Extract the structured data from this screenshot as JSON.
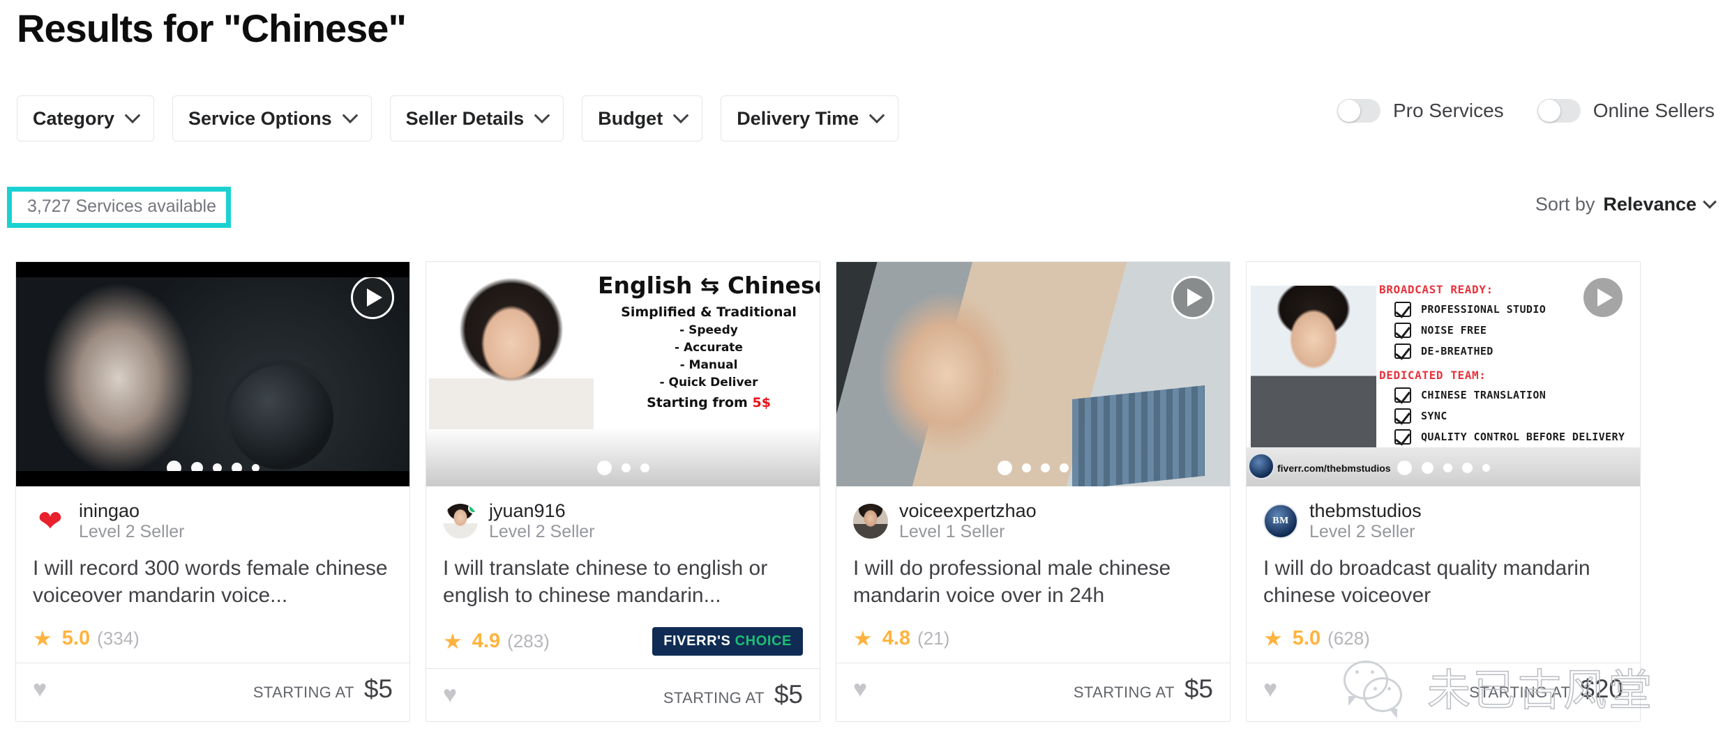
{
  "header": {
    "title": "Results for \"Chinese\""
  },
  "filters": {
    "buttons": [
      {
        "label": "Category",
        "icon": "chevron-down-icon"
      },
      {
        "label": "Service Options",
        "icon": "chevron-down-icon"
      },
      {
        "label": "Seller Details",
        "icon": "chevron-down-icon"
      },
      {
        "label": "Budget",
        "icon": "chevron-down-icon"
      },
      {
        "label": "Delivery Time",
        "icon": "chevron-down-icon"
      }
    ],
    "toggles": [
      {
        "label": "Pro Services",
        "on": false
      },
      {
        "label": "Online Sellers",
        "on": false
      }
    ]
  },
  "results": {
    "count_text": "3,727 Services available",
    "highlight_color": "#1ad1d1",
    "sort_prefix": "Sort by",
    "sort_value": "Relevance",
    "sort_icon": "chevron-down-icon"
  },
  "cards": [
    {
      "media_kind": "studio",
      "has_play": true,
      "play_icon": "play-button-icon",
      "dots": 5,
      "avatar_kind": "heart",
      "avatar_glyph": "❤",
      "avatar_icon": "heart-avatar-icon",
      "online": false,
      "seller": "iningao",
      "level": "Level 2 Seller",
      "title": "I will record 300 words female chinese voiceover mandarin voice...",
      "star_icon": "star-icon",
      "score": "5.0",
      "reviews": "(334)",
      "badge": null,
      "fav_icon": "heart-outline-icon",
      "fav_glyph": "♥",
      "price_label": "STARTING AT",
      "price": "$5"
    },
    {
      "media_kind": "promo",
      "has_play": false,
      "play_icon": null,
      "dots": 3,
      "avatar_kind": "ph-woman",
      "avatar_icon": "seller-avatar-icon",
      "online": true,
      "seller": "jyuan916",
      "level": "Level 2 Seller",
      "title": "I will translate chinese to english or english to chinese mandarin...",
      "star_icon": "star-icon",
      "score": "4.9",
      "reviews": "(283)",
      "badge": {
        "first": "FIVERR'S",
        "second": "CHOICE",
        "bg": "#102c54",
        "accent": "#1dbf73"
      },
      "fav_icon": "heart-outline-icon",
      "fav_glyph": "♥",
      "price_label": "STARTING AT",
      "price": "$5",
      "promo": {
        "heading": "English ⇆ Chinese",
        "subheading": "Simplified & Traditional",
        "bullets": [
          "- Speedy",
          "- Accurate",
          "- Manual",
          "- Quick Deliver"
        ],
        "price_prefix": "Starting from ",
        "price_value": "5$"
      }
    },
    {
      "media_kind": "room",
      "has_play": true,
      "play_icon": "play-button-icon",
      "dots": 4,
      "avatar_kind": "ph-man",
      "avatar_icon": "seller-avatar-icon",
      "online": false,
      "seller": "voiceexpertzhao",
      "level": "Level 1 Seller",
      "title": "I will do professional male chinese mandarin voice over in 24h",
      "star_icon": "star-icon",
      "score": "4.8",
      "reviews": "(21)",
      "badge": null,
      "fav_icon": "heart-outline-icon",
      "fav_glyph": "♥",
      "price_label": "STARTING AT",
      "price": "$5"
    },
    {
      "media_kind": "checklist",
      "has_play": true,
      "play_icon": "play-button-icon",
      "dots": 5,
      "avatar_kind": "bm",
      "avatar_icon": "seller-avatar-icon",
      "avatar_text": "BM",
      "online": false,
      "seller": "thebmstudios",
      "level": "Level 2 Seller",
      "title": "I will do broadcast quality mandarin chinese voiceover",
      "star_icon": "star-icon",
      "score": "5.0",
      "reviews": "(628)",
      "badge": null,
      "fav_icon": "heart-outline-icon",
      "fav_glyph": "♥",
      "price_label": "STARTING AT",
      "price": "$20",
      "checklist": {
        "head1": "BROADCAST READY:",
        "items1": [
          "PROFESSIONAL STUDIO",
          "NOISE FREE",
          "DE-BREATHED"
        ],
        "head2": "DEDICATED TEAM:",
        "items2": [
          "CHINESE TRANSLATION",
          "SYNC",
          "QUALITY CONTROL BEFORE DELIVERY"
        ],
        "url": "fiverr.com/thebmstudios"
      }
    }
  ],
  "watermark": {
    "text": "未已古风堂",
    "logo": "wechat-icon"
  }
}
